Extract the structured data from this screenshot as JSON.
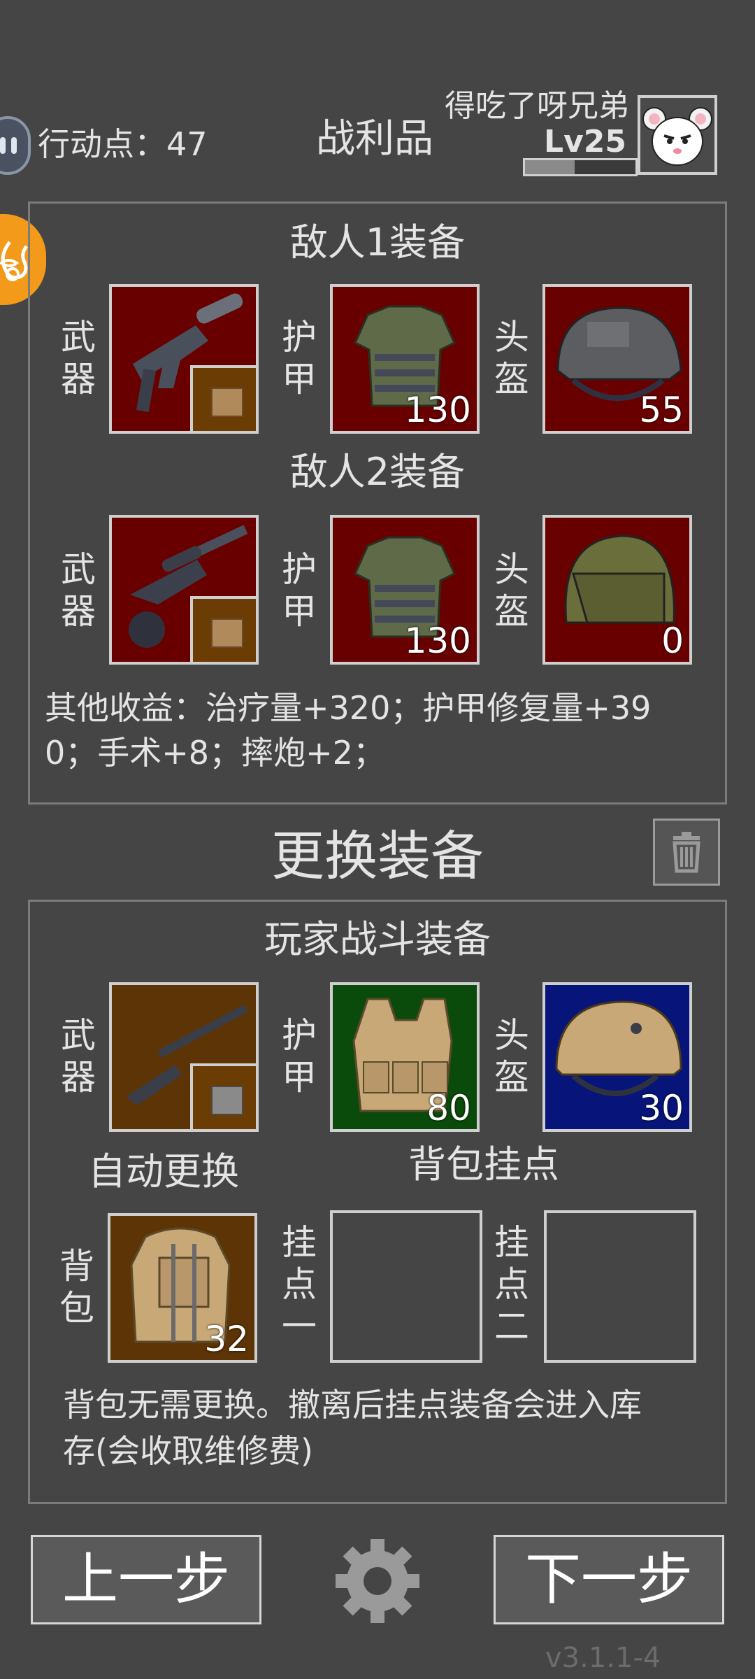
{
  "header": {
    "action_points": "行动点：47",
    "title": "战利品",
    "player_name": "得吃了呀兄弟",
    "level": "Lv25",
    "xp_progress": 0.45
  },
  "loot": {
    "enemy1_title": "敌人1装备",
    "enemy2_title": "敌人2装备",
    "weapon_label": "武器",
    "armor_label": "护甲",
    "helmet_label": "头盔",
    "enemy1": {
      "weapon_icon": "smg-silenced-icon",
      "armor_value": "130",
      "helmet_value": "55"
    },
    "enemy2": {
      "weapon_icon": "sniper-rifle-icon",
      "armor_value": "130",
      "helmet_value": "0"
    },
    "other_gains_line1": "其他收益：治疗量+320；护甲修复量+39",
    "other_gains_line2": "0；手术+8；摔炮+2；"
  },
  "change": {
    "title": "更换装备",
    "player_title": "玩家战斗装备",
    "armor_value": "80",
    "helmet_value": "30",
    "auto_replace": "自动更换",
    "backpack_mounts": "背包挂点",
    "backpack_label": "背包",
    "backpack_value": "32",
    "mount1_label": "挂点一",
    "mount2_label": "挂点二",
    "note_line1": "背包无需更换。撤离后挂点装备会进入库",
    "note_line2": "存(会收取维修费)"
  },
  "footer": {
    "prev": "上一步",
    "next": "下一步",
    "version": "v3.1.1-4"
  },
  "colors": {
    "background": "#454545",
    "loot_slot": "#690000",
    "armor_slot": "#0a4a0a",
    "helmet_slot": "#07147a",
    "weapon_slot": "#5d3405",
    "badge": "#f39a1a"
  }
}
